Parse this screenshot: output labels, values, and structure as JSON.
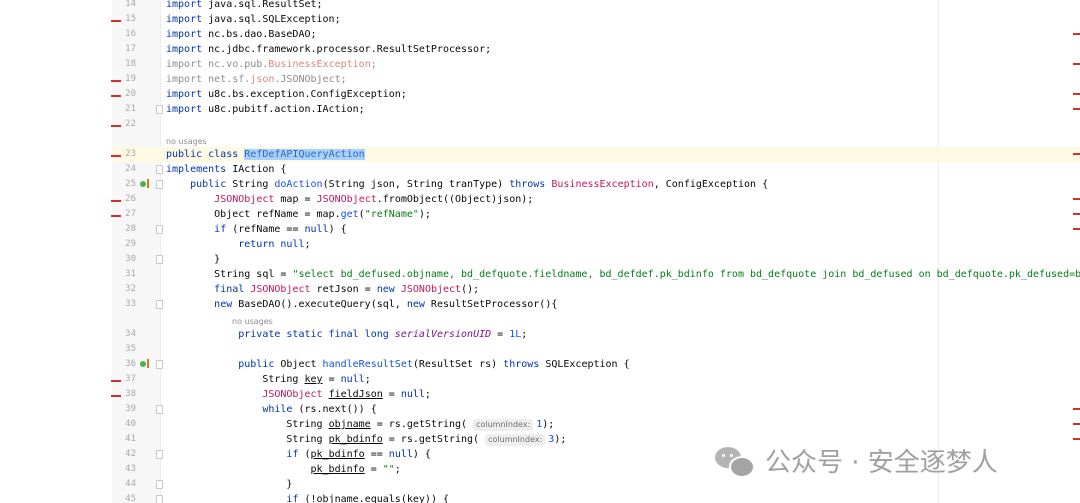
{
  "editor": {
    "lines": [
      {
        "n": "14",
        "html": "<span class=\"kw\">import</span> java.sql.ResultSet;"
      },
      {
        "n": "15",
        "html": "<span class=\"kw\">import</span> java.sql.SQLException;"
      },
      {
        "n": "16",
        "html": "<span class=\"kw\">import</span> nc.bs.dao.BaseDAO;"
      },
      {
        "n": "17",
        "html": "<span class=\"kw\">import</span> nc.jdbc.framework.processor.ResultSetProcessor;"
      },
      {
        "n": "18",
        "html": "<span class=\"dim\">import nc.vo.pub.</span><span class=\"cls-dim\">BusinessException</span><span class=\"dim\">;</span>"
      },
      {
        "n": "19",
        "html": "<span class=\"dim\">import net.sf.</span><span class=\"cls-dim\">json</span><span class=\"dim\">.JSONObject;</span>"
      },
      {
        "n": "20",
        "html": "<span class=\"kw\">import</span> u8c.bs.exception.ConfigException;"
      },
      {
        "n": "21",
        "html": "<span class=\"kw\">import</span> u8c.pubitf.action.IAction;"
      },
      {
        "n": "22",
        "html": ""
      },
      {
        "hint": "no usages"
      },
      {
        "n": "23",
        "hl": true,
        "html": "<span class=\"kw\">public class</span> <span class=\"sel\">RefDefAPIQueryAction</span>"
      },
      {
        "n": "24",
        "html": "<span class=\"kw\">implements</span> IAction {"
      },
      {
        "n": "25",
        "html": "    <span class=\"kw\">public</span> String <span class=\"num\">doAction</span>(String json, String tranType) <span class=\"kw\">throws</span> <span class=\"cls\">BusinessException</span>, ConfigException {"
      },
      {
        "n": "26",
        "html": "        <span class=\"cls\">JSONObject</span> map = <span class=\"cls\">JSONObject</span>.fromObject((Object)json);"
      },
      {
        "n": "27",
        "html": "        Object refName = map.<span class=\"num\">get</span>(<span class=\"str\">\"refName\"</span>);"
      },
      {
        "n": "28",
        "html": "        <span class=\"kw\">if</span> (refName == <span class=\"kw\">null</span>) {"
      },
      {
        "n": "29",
        "html": "            <span class=\"kw\">return null</span>;"
      },
      {
        "n": "30",
        "html": "        }"
      },
      {
        "n": "31",
        "html": "        String sql = <span class=\"str\">\"select bd_defused.objname, bd_defquote.fieldname, bd_defdef.pk_bdinfo from bd_defquote join bd_defused on bd_defquote.pk_defused=bd_defused.pk_d</span>"
      },
      {
        "n": "32",
        "html": "        <span class=\"kw\">final</span> <span class=\"cls\">JSONObject</span> retJson = <span class=\"kw\">new</span> <span class=\"cls\">JSONObject</span>();"
      },
      {
        "n": "33",
        "html": "        <span class=\"kw\">new</span> BaseDAO().executeQuery(sql, <span class=\"kw\">new</span> ResultSetProcessor(){"
      },
      {
        "hint": "no usages",
        "indent": "            "
      },
      {
        "n": "34",
        "html": "            <span class=\"kw\">private static final long</span> <span class=\"fld\">serialVersionUID</span> = <span class=\"num\">1L</span>;"
      },
      {
        "n": "35",
        "html": ""
      },
      {
        "n": "36",
        "html": "            <span class=\"kw\">public</span> Object <span class=\"num\">handleResultSet</span>(ResultSet rs) <span class=\"kw\">throws</span> SQLException {"
      },
      {
        "n": "37",
        "html": "                String <span class=\"under\">key</span> = <span class=\"kw\">null</span>;"
      },
      {
        "n": "38",
        "html": "                <span class=\"cls\">JSONObject</span> <span class=\"under\">fieldJson</span> = <span class=\"kw\">null</span>;"
      },
      {
        "n": "39",
        "html": "                <span class=\"kw\">while</span> (rs.next()) {"
      },
      {
        "n": "40",
        "html": "                    String <span class=\"under\">objname</span> = rs.getString( <span class=\"ph\">columnIndex:</span><span class=\"num\">1</span>);"
      },
      {
        "n": "41",
        "html": "                    String <span class=\"under\">pk_bdinfo</span> = rs.getString( <span class=\"ph\">columnIndex:</span><span class=\"num\">3</span>);"
      },
      {
        "n": "42",
        "html": "                    <span class=\"kw\">if</span> (<span class=\"under\">pk_bdinfo</span> == <span class=\"kw\">null</span>) {"
      },
      {
        "n": "43",
        "html": "                        <span class=\"under\">pk_bdinfo</span> = <span class=\"str\">\"\"</span>;"
      },
      {
        "n": "44",
        "html": "                    }"
      },
      {
        "n": "45",
        "html": "                    <span class=\"kw\">if</span> (!<span class=\"under\">objname</span>.equals(<span class=\"under\">key</span>)) {"
      }
    ]
  },
  "watermark": {
    "text": "公众号 · 安全逐梦人",
    "icon": "wechat-icon"
  }
}
